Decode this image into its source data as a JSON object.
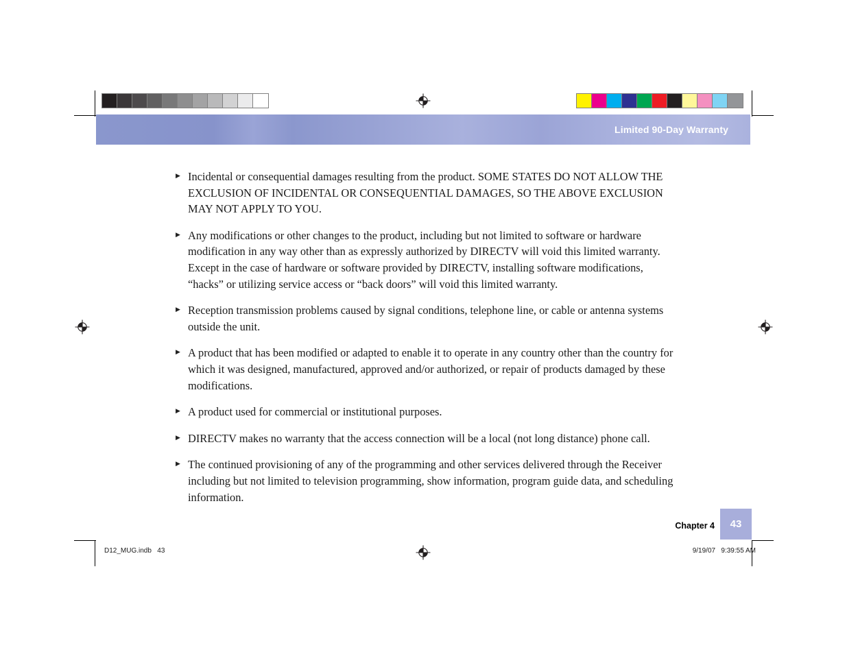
{
  "header": {
    "title": "Limited 90-Day Warranty"
  },
  "body": {
    "bullet_glyph": "▶",
    "items": [
      {
        "text": "Incidental or consequential damages resulting from the product. SOME STATES DO NOT ALLOW THE EXCLUSION OF INCIDENTAL OR CONSEQUENTIAL DAMAGES, SO THE ABOVE EXCLUSION MAY NOT APPLY TO YOU."
      },
      {
        "text": "Any modifications or other changes to the product, including but not limited to software or hardware modification in any way other than as expressly authorized by DIRECTV will void this limited warranty. Except in the case of hardware or software provided by DIRECTV, installing software modifications, “hacks” or utilizing service access or “back doors” will void this limited warranty."
      },
      {
        "text": "Reception transmission problems caused by signal conditions, telephone line, or cable or antenna systems outside the unit."
      },
      {
        "text": "A product that has been modified or adapted to enable it to operate in any country other than the country for which it was designed, manufactured, approved and/or authorized, or repair of products damaged by these modifications."
      },
      {
        "text": "A product used for commercial or institutional purposes."
      },
      {
        "text": "DIRECTV makes no warranty that the access connection will be a local (not long distance) phone call."
      },
      {
        "text": "The continued provisioning of any of the programming and other services delivered through the Receiver including but not limited to television programming, show information, program guide data, and scheduling information."
      }
    ]
  },
  "footer": {
    "chapter_label": "Chapter 4",
    "page_number": "43",
    "slug_left": "D12_MUG.indb   43",
    "slug_right": "9/19/07   9:39:55 AM"
  },
  "printer_marks": {
    "grayscale_swatches": [
      "#231f20",
      "#3b3739",
      "#4d4a4c",
      "#616061",
      "#787879",
      "#8e8e8f",
      "#a3a3a4",
      "#b9b9ba",
      "#d2d2d3",
      "#ebebec",
      "#ffffff"
    ],
    "color_swatches": [
      "#fff200",
      "#ec008c",
      "#00aeef",
      "#2e3192",
      "#00a651",
      "#ed1c24",
      "#231f20",
      "#fff79a",
      "#f490c0",
      "#7fd4f4",
      "#939598"
    ],
    "registration_mark_name": "registration-target"
  },
  "theme": {
    "band_accent": "#8a97cd",
    "badge_accent": "#a8aedb",
    "text_color": "#1b1b1b"
  }
}
